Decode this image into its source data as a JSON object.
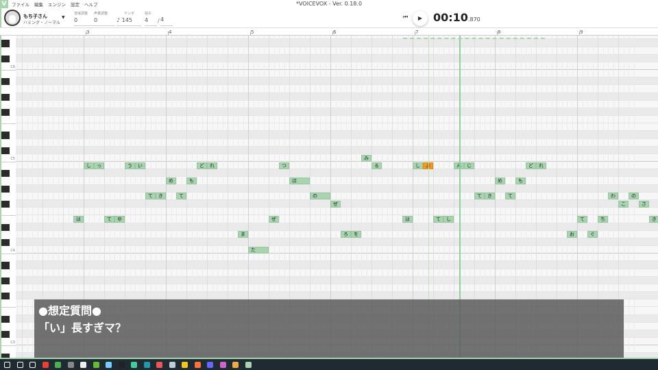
{
  "window": {
    "title": "*VOICEVOX - Ver. 0.18.0",
    "logo": "V"
  },
  "menu": [
    "ファイル",
    "編集",
    "エンジン",
    "設定",
    "ヘルプ"
  ],
  "character": {
    "name": "もち子さん",
    "style": "ハミング・ノーマル"
  },
  "fields": {
    "pitch_label": "音域調整",
    "pitch": "0",
    "volume_label": "声量調整",
    "volume": "0",
    "tempo_label": "テンポ",
    "tempo": "145",
    "beat_label": "拍子",
    "beats": "4",
    "slash": "/",
    "beat_type": "4"
  },
  "transport": {
    "time": "00:10",
    "ms": ".870"
  },
  "ruler": [
    "3",
    "4",
    "5",
    "6",
    "7",
    "8",
    "9"
  ],
  "key_labels": [
    {
      "midi": 84,
      "label": "C6"
    },
    {
      "midi": 72,
      "label": "C5"
    },
    {
      "midi": 60,
      "label": "C4"
    },
    {
      "midi": 48,
      "label": "C3"
    }
  ],
  "accent": "#a8d5b0",
  "selected_color": "#f39a1e",
  "notes": [
    {
      "l": "は",
      "p": 64,
      "b": 7.5,
      "d": 0.5
    },
    {
      "l": "し",
      "p": 71,
      "b": 8,
      "d": 0.5
    },
    {
      "l": "っ",
      "p": 71,
      "b": 8.5,
      "d": 0.5
    },
    {
      "l": "て",
      "p": 64,
      "b": 9,
      "d": 0.5
    },
    {
      "l": "ゆ",
      "p": 64,
      "b": 9.5,
      "d": 0.5
    },
    {
      "l": "う",
      "p": 71,
      "b": 10,
      "d": 0.5
    },
    {
      "l": "い",
      "p": 71,
      "b": 10.5,
      "d": 0.5
    },
    {
      "l": "て",
      "p": 67,
      "b": 11,
      "d": 0.5
    },
    {
      "l": "き",
      "p": 67,
      "b": 11.5,
      "d": 0.5
    },
    {
      "l": "め",
      "p": 69,
      "b": 12,
      "d": 0.5
    },
    {
      "l": "て",
      "p": 67,
      "b": 12.5,
      "d": 0.5
    },
    {
      "l": "も",
      "p": 69,
      "b": 13,
      "d": 0.5
    },
    {
      "l": "ど",
      "p": 71,
      "b": 13.5,
      "d": 0.5
    },
    {
      "l": "れ",
      "p": 71,
      "b": 14,
      "d": 0.5
    },
    {
      "l": "ま",
      "p": 62,
      "b": 15.5,
      "d": 0.5
    },
    {
      "l": "た",
      "p": 60,
      "b": 16,
      "d": 1
    },
    {
      "l": "ぜ",
      "p": 64,
      "b": 17,
      "d": 0.5
    },
    {
      "l": "つ",
      "p": 71,
      "b": 17.5,
      "d": 0.5
    },
    {
      "l": "ほ",
      "p": 69,
      "b": 18,
      "d": 1
    },
    {
      "l": "の",
      "p": 67,
      "b": 19,
      "d": 1
    },
    {
      "l": "ぜ",
      "p": 66,
      "b": 20,
      "d": 0.5
    },
    {
      "l": "ろ",
      "p": 62,
      "b": 20.5,
      "d": 0.5
    },
    {
      "l": "を",
      "p": 62,
      "b": 21,
      "d": 0.5
    },
    {
      "l": "み",
      "p": 72,
      "b": 21.5,
      "d": 0.5
    },
    {
      "l": "る",
      "p": 71,
      "b": 22,
      "d": 0.5
    },
    {
      "l": "は",
      "p": 64,
      "b": 23.5,
      "d": 0.5
    },
    {
      "l": "し",
      "p": 71,
      "b": 24,
      "d": 0.5
    },
    {
      "l": "ぶ",
      "p": 71,
      "b": 24.5,
      "d": 0.5,
      "sel": true
    },
    {
      "l": "て",
      "p": 64,
      "b": 25,
      "d": 0.5
    },
    {
      "l": "し",
      "p": 64,
      "b": 25.5,
      "d": 0.5
    },
    {
      "l": "ん",
      "p": 71,
      "b": 26,
      "d": 0.5
    },
    {
      "l": "じ",
      "p": 71,
      "b": 26.5,
      "d": 0.5
    },
    {
      "l": "て",
      "p": 67,
      "b": 27,
      "d": 0.5
    },
    {
      "l": "き",
      "p": 67,
      "b": 27.5,
      "d": 0.5
    },
    {
      "l": "め",
      "p": 69,
      "b": 28,
      "d": 0.5
    },
    {
      "l": "て",
      "p": 67,
      "b": 28.5,
      "d": 0.5
    },
    {
      "l": "も",
      "p": 69,
      "b": 29,
      "d": 0.5
    },
    {
      "l": "ど",
      "p": 71,
      "b": 29.5,
      "d": 0.5
    },
    {
      "l": "れ",
      "p": 71,
      "b": 30,
      "d": 0.5
    },
    {
      "l": "お",
      "p": 62,
      "b": 31.5,
      "d": 0.5
    },
    {
      "l": "て",
      "p": 64,
      "b": 32,
      "d": 0.5
    },
    {
      "l": "ぐ",
      "p": 62,
      "b": 32.5,
      "d": 0.5
    },
    {
      "l": "ち",
      "p": 64,
      "b": 33,
      "d": 0.5
    },
    {
      "l": "わ",
      "p": 67,
      "b": 33.5,
      "d": 0.5
    },
    {
      "l": "こ",
      "p": 66,
      "b": 34,
      "d": 0.5
    },
    {
      "l": "の",
      "p": 67,
      "b": 34.5,
      "d": 0.5
    },
    {
      "l": "さ",
      "p": 66,
      "b": 35,
      "d": 0.5
    },
    {
      "l": "き",
      "p": 64,
      "b": 35.5,
      "d": 0.5
    }
  ],
  "overlay": {
    "line1": "●想定質問●",
    "line2": "「い」長すぎマ？"
  },
  "taskbar_icons": [
    "windows-start",
    "search",
    "task-view",
    "chrome",
    "chrome-alt",
    "obs",
    "app",
    "app",
    "app",
    "app",
    "app",
    "app",
    "app",
    "app",
    "explorer",
    "firefox",
    "app",
    "app",
    "app",
    "voicevox"
  ]
}
